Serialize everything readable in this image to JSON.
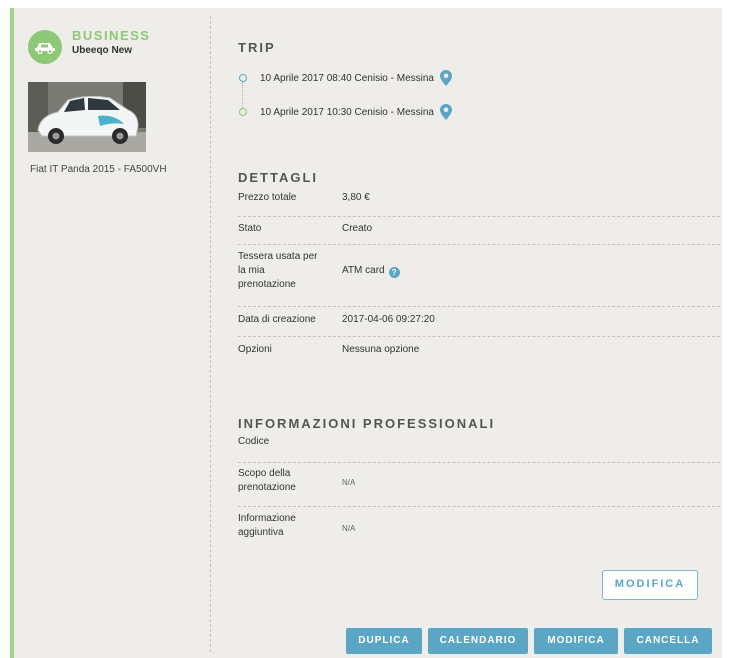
{
  "sidebar": {
    "category": "BUSINESS",
    "provider": "Ubeeqo New",
    "vehicle": "Fiat IT Panda 2015 - FA500VH"
  },
  "trip": {
    "title": "TRIP",
    "stops": [
      {
        "text": "10 Aprile 2017 08:40 Cenisio - Messina",
        "color": "#5aa6c4"
      },
      {
        "text": "10 Aprile 2017 10:30 Cenisio - Messina",
        "color": "#8dc877"
      }
    ]
  },
  "details": {
    "title": "DETTAGLI",
    "rows": [
      {
        "label": "Prezzo totale",
        "value": "3,80 €"
      },
      {
        "label": "Stato",
        "value": "Creato"
      },
      {
        "label": "Tessera usata per la mia prenotazione",
        "value": "ATM card"
      },
      {
        "label": "Data di creazione",
        "value": "2017-04-06 09:27:20"
      },
      {
        "label": "Opzioni",
        "value": "Nessuna opzione"
      }
    ]
  },
  "professional": {
    "title": "INFORMAZIONI PROFESSIONALI",
    "rows": [
      {
        "label": "Codice",
        "value": ""
      },
      {
        "label": "Scopo della prenotazione",
        "value": "N/A"
      },
      {
        "label": "Informazione aggiuntiva",
        "value": "N/A"
      }
    ],
    "edit_button": "MODIFICA"
  },
  "actions": {
    "duplicate": "DUPLICA",
    "calendar": "CALENDARIO",
    "edit": "MODIFICA",
    "cancel": "CANCELLA"
  },
  "colors": {
    "accent_green": "#8dc877",
    "accent_blue": "#5aa6c4",
    "card_bg": "#efedea"
  }
}
